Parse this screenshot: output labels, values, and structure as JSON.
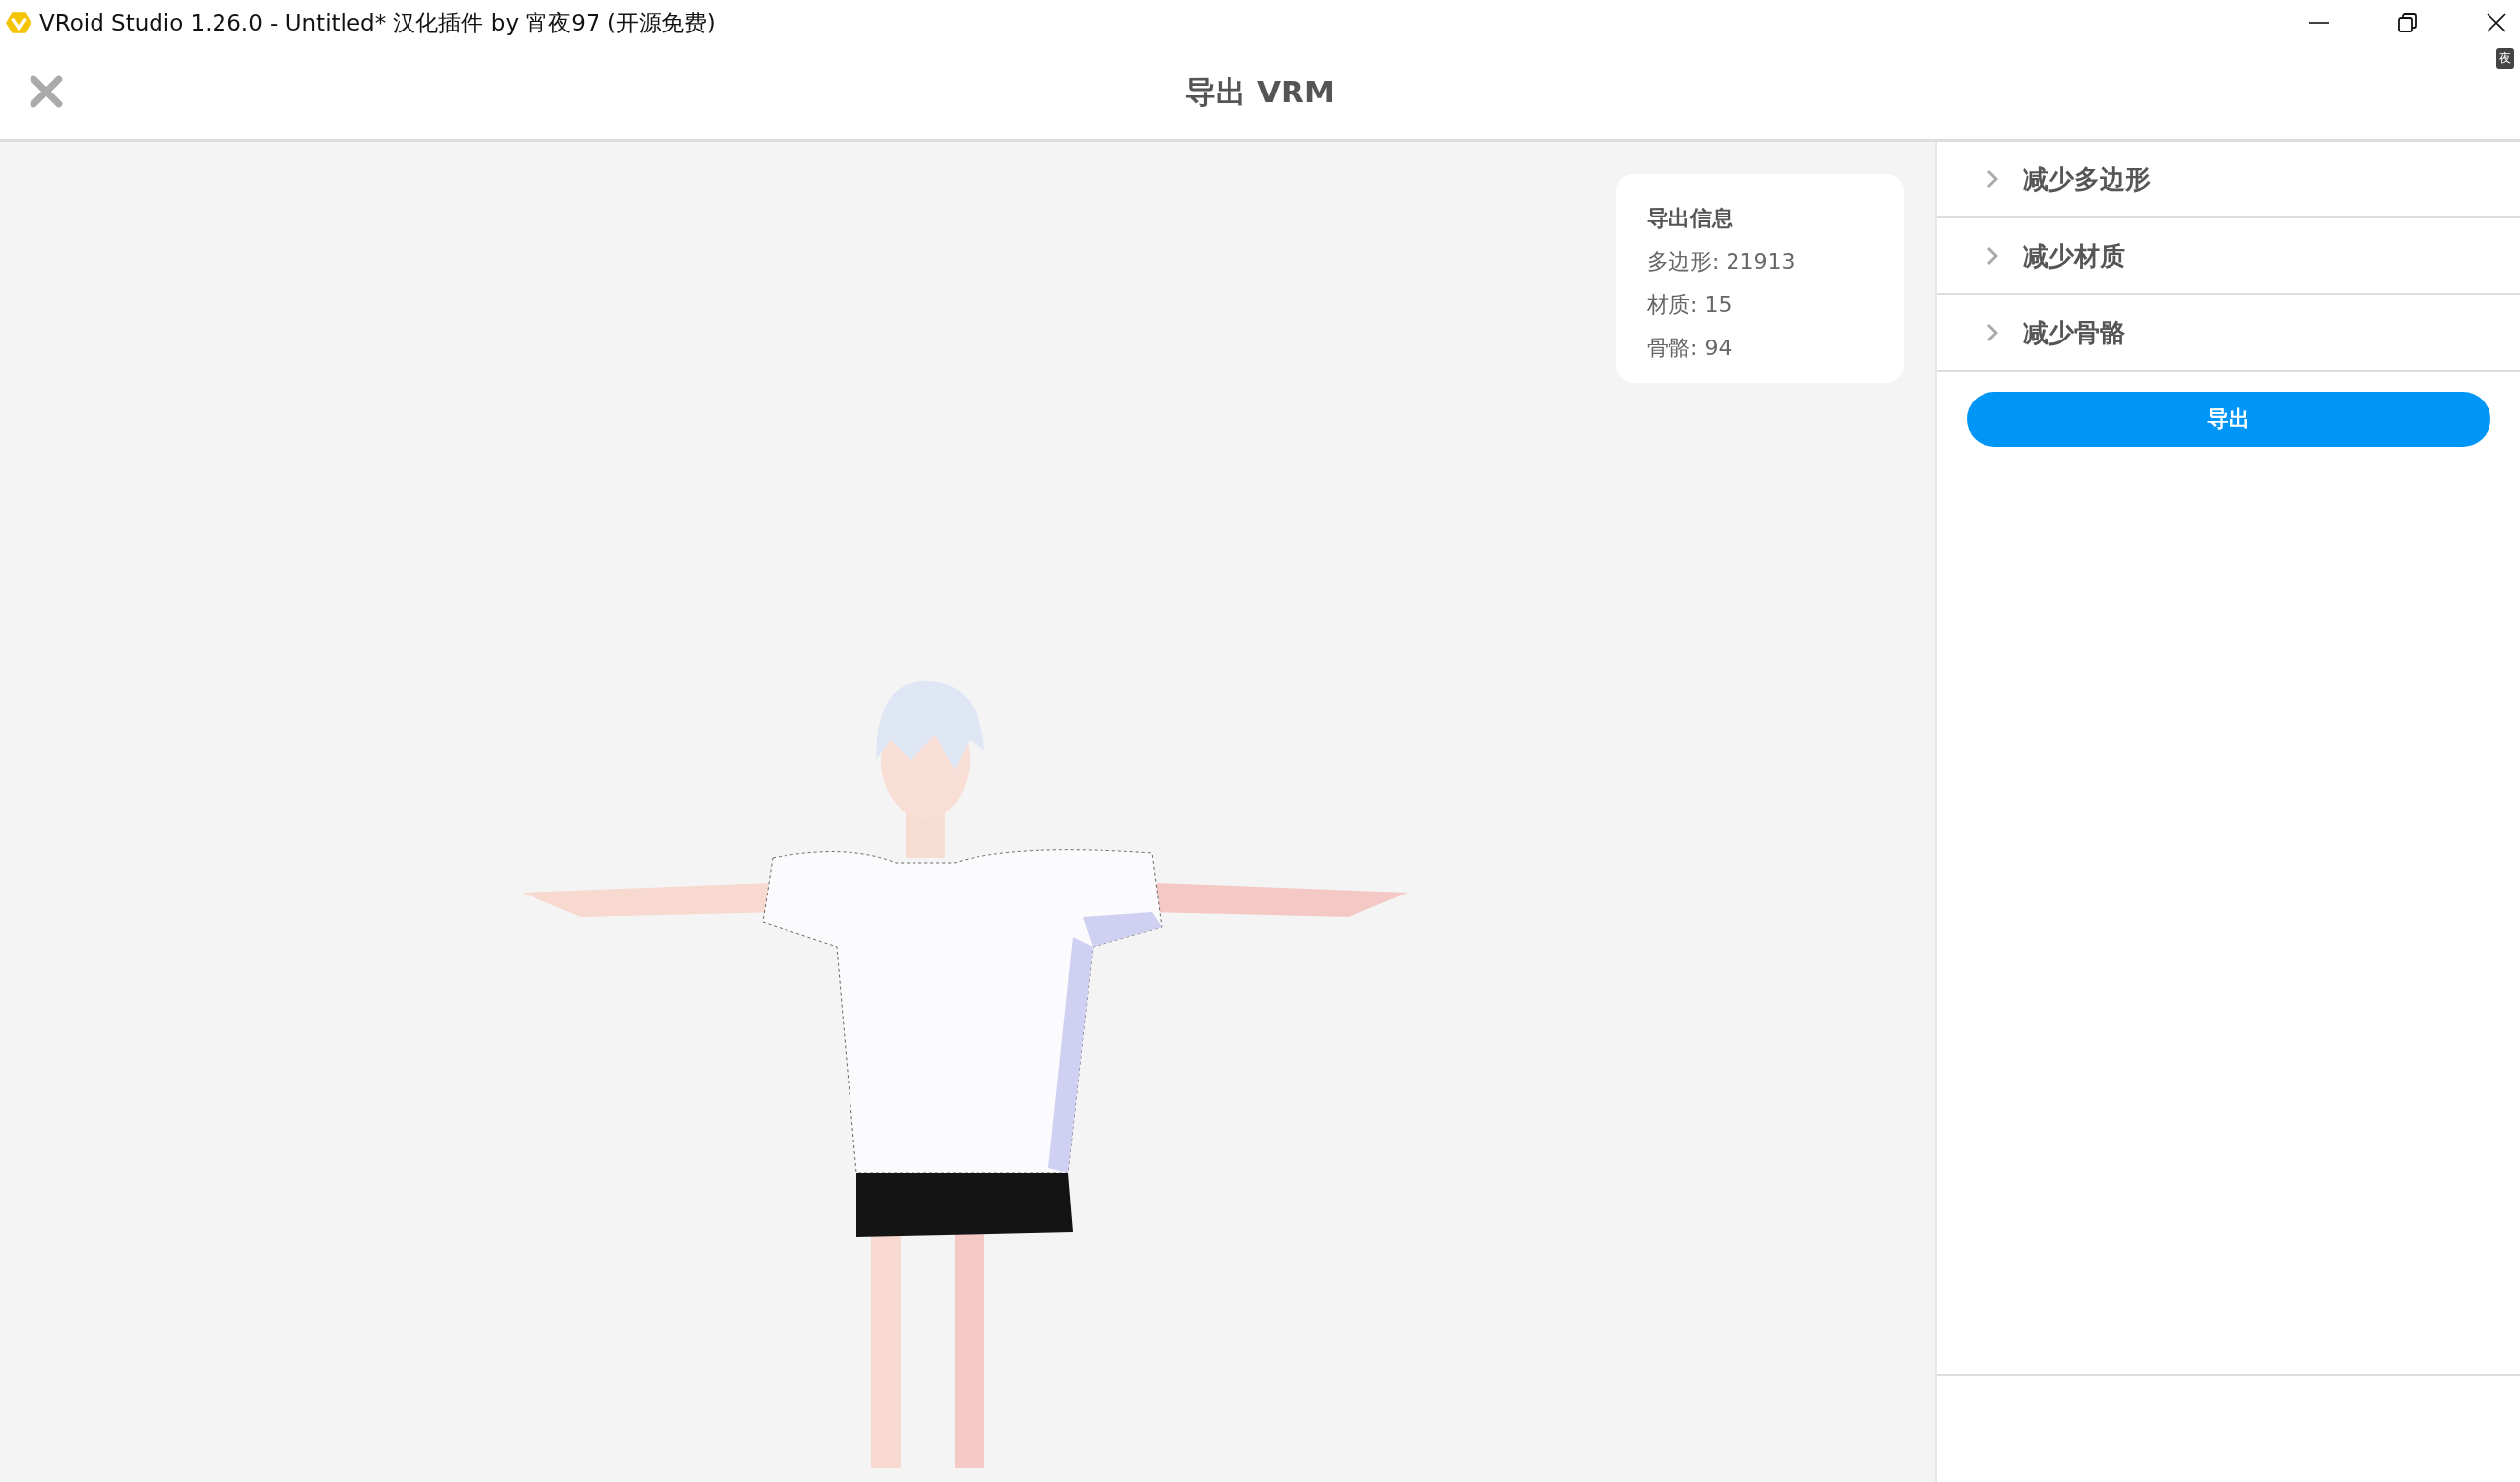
{
  "window": {
    "title": "VRoid Studio 1.26.0 - Untitled* 汉化插件 by 宵夜97 (开源免费)",
    "badge": "夜"
  },
  "header": {
    "title": "导出 VRM"
  },
  "info_card": {
    "title": "导出信息",
    "lines": [
      "多边形: 21913",
      "材质: 15",
      "骨骼: 94"
    ]
  },
  "sections": [
    {
      "label": "减少多边形",
      "expanded": false
    },
    {
      "label": "减少材质",
      "expanded": false
    },
    {
      "label": "减少骨骼",
      "expanded": false
    }
  ],
  "export_button": "导出"
}
